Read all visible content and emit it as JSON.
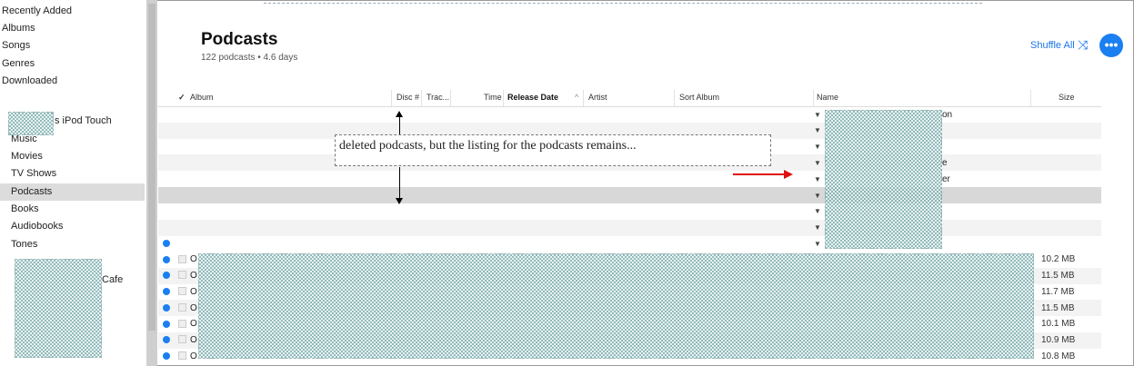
{
  "sidebar": {
    "library_items": [
      "Recently Added",
      "Albums",
      "Songs",
      "Genres",
      "Downloaded"
    ],
    "device_name_suffix": "s iPod Touch",
    "device_items": [
      "Music",
      "Movies",
      "TV Shows",
      "Podcasts",
      "Books",
      "Audiobooks",
      "Tones"
    ],
    "playlist_fragment": "Cafe",
    "selected": "Podcasts"
  },
  "header": {
    "title": "Podcasts",
    "subtitle": "122 podcasts • 4.6 days",
    "shuffle_label": "Shuffle All",
    "more_label": "•••"
  },
  "columns": {
    "check": "✓",
    "album": "Album",
    "disc": "Disc #",
    "track": "Trac...",
    "time": "Time",
    "release": "Release Date",
    "artist": "Artist",
    "sort_album": "Sort Album",
    "name": "Name",
    "size": "Size"
  },
  "group_rows": [
    {
      "tail": "on"
    },
    {
      "tail": ""
    },
    {
      "tail": ""
    },
    {
      "tail": "e"
    },
    {
      "tail": "er"
    },
    {
      "tail": ""
    },
    {
      "tail": ""
    },
    {
      "tail": ""
    },
    {
      "tail": ""
    }
  ],
  "episode_rows": [
    {
      "prefix": "O",
      "size": "10.2 MB"
    },
    {
      "prefix": "O",
      "size": "11.5 MB"
    },
    {
      "prefix": "O",
      "size": "11.7 MB"
    },
    {
      "prefix": "O",
      "size": "11.5 MB"
    },
    {
      "prefix": "O",
      "size": "10.1 MB"
    },
    {
      "prefix": "O",
      "size": "10.9 MB"
    },
    {
      "prefix": "O",
      "size": "10.8 MB"
    }
  ],
  "annotation": "deleted podcasts, but the listing for the podcasts remains...",
  "colors": {
    "accent": "#1a7ff0",
    "arrow": "#e01010"
  },
  "icons": [
    "shuffle-icon",
    "more-icon",
    "disclosure-triangle-icon",
    "playing-dot-icon"
  ]
}
